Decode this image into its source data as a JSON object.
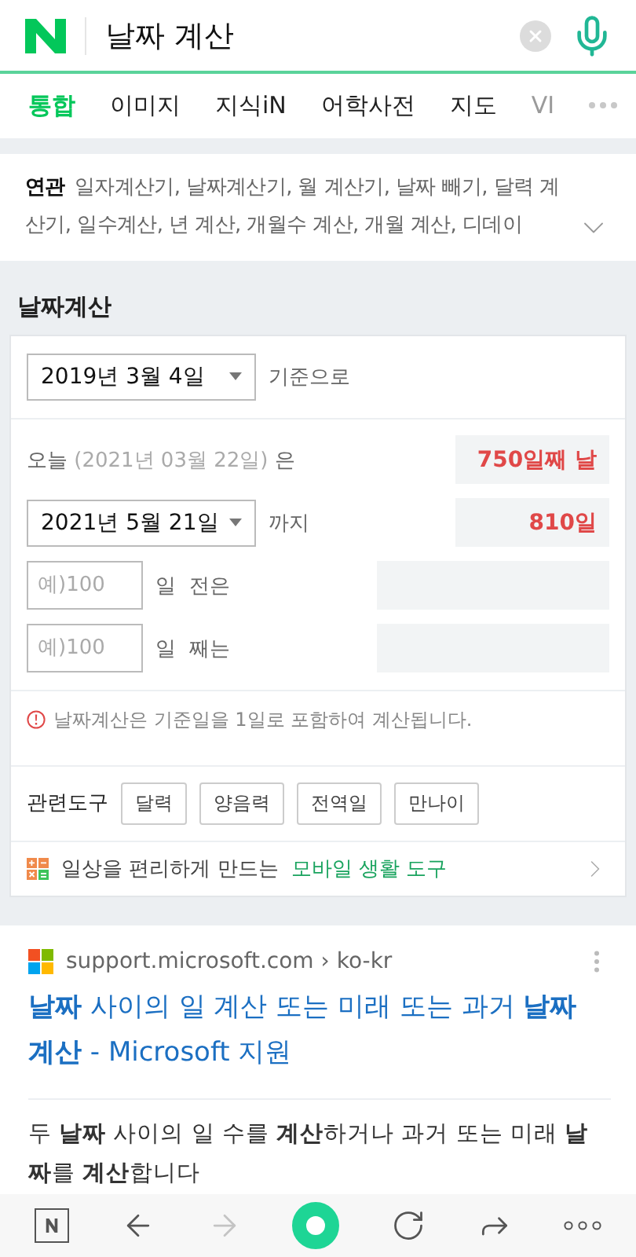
{
  "search": {
    "query": "날짜 계산"
  },
  "tabs": [
    {
      "label": "통합",
      "selected": true,
      "faded": false
    },
    {
      "label": "이미지",
      "selected": false,
      "faded": false
    },
    {
      "label": "지식iN",
      "selected": false,
      "faded": false
    },
    {
      "label": "어학사전",
      "selected": false,
      "faded": false
    },
    {
      "label": "지도",
      "selected": false,
      "faded": false
    },
    {
      "label": "VI",
      "selected": false,
      "faded": true
    }
  ],
  "related": {
    "label": "연관",
    "text": "일자계산기, 날짜계산기, 월 계산기, 날짜 빼기, 달력 계산기, 일수계산, 년 계산, 개월수 계산, 개월 계산, 디데이"
  },
  "calculator": {
    "title": "날짜계산",
    "base_date": "2019년 3월 4일",
    "base_suffix": "기준으로",
    "today_label": "오늘",
    "today_date": "(2021년 03월 22일)",
    "today_suffix": "은",
    "today_result": "750일째 날",
    "target_date": "2021년 5월 21일",
    "target_suffix": "까지",
    "target_result": "810일",
    "inputs": [
      {
        "placeholder": "예)100",
        "unit": "일",
        "suffix": "전은"
      },
      {
        "placeholder": "예)100",
        "unit": "일",
        "suffix": "째는"
      }
    ],
    "notice": "날짜계산은 기준일을 1일로 포함하여 계산됩니다.",
    "tools_label": "관련도구",
    "tools": [
      "달력",
      "양음력",
      "전역일",
      "만나이"
    ],
    "promo_text": "일상을 편리하게 만드는",
    "promo_link": "모바일 생활 도구"
  },
  "result": {
    "site": "support.microsoft.com",
    "separator": "›",
    "path": "ko-kr",
    "title": "**날짜** 사이의 일 계산 또는 미래 또는 과거 **날짜 계산** - Microsoft 지원",
    "description": "두 **날짜** 사이의 일 수를 **계산**하거나 과거 또는 미래 **날짜**를 **계산**합니다"
  },
  "bottom_nav": [
    {
      "kind": "home",
      "disabled": false
    },
    {
      "kind": "back",
      "disabled": false
    },
    {
      "kind": "forward",
      "disabled": true
    },
    {
      "kind": "green",
      "disabled": false
    },
    {
      "kind": "refresh",
      "disabled": false
    },
    {
      "kind": "share",
      "disabled": false
    },
    {
      "kind": "more",
      "disabled": false
    }
  ]
}
